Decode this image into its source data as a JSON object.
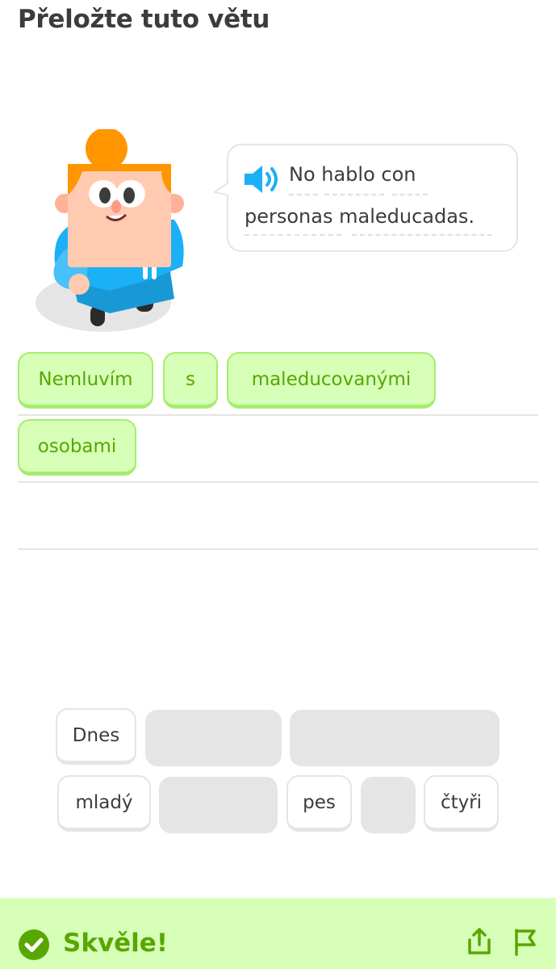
{
  "header": {
    "title": "Přeložte tuto větu"
  },
  "prompt": {
    "line1": "No hablo con",
    "line2": "personas maleducadas.",
    "speaker_icon": "speaker-icon",
    "speaker_color": "#1cb0f6"
  },
  "answer": {
    "tiles": [
      "Nemluvím",
      "s",
      "maleducovanými",
      "osobami"
    ]
  },
  "word_bank": {
    "tiles": [
      "Dnes",
      "mladý",
      "pes",
      "čtyři"
    ],
    "empty_slots": 5
  },
  "feedback": {
    "message": "Skvěle!",
    "status_icon": "check-circle-icon",
    "share_icon": "share-icon",
    "report_icon": "flag-icon",
    "color": "#58a700",
    "background": "#d7ffb8"
  }
}
